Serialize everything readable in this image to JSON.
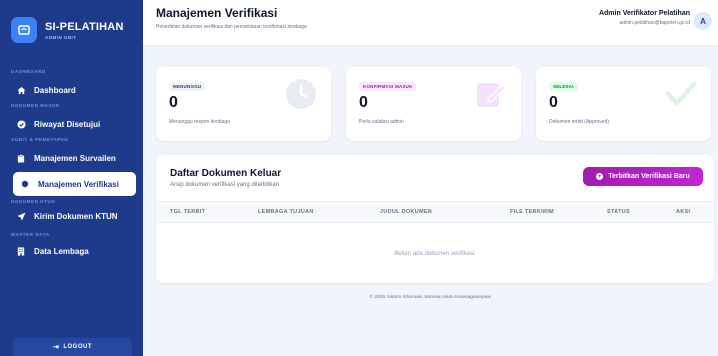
{
  "sidebar": {
    "brand_title": "SI-PELATIHAN",
    "brand_subtitle": "ADMIN UNIT",
    "sections": [
      "DASHBOARD",
      "DOKUMEN MASUK",
      "AUDIT & PEMETAPAN",
      "DOKUMEN KTUN",
      "MASTER DATA"
    ],
    "items": [
      {
        "label": "Dashboard",
        "icon": "home-icon"
      },
      {
        "label": "Riwayat Disetujui",
        "icon": "check-circle-icon"
      },
      {
        "label": "Manajemen Survailen",
        "icon": "clipboard-icon"
      },
      {
        "label": "Manajemen Verifikasi",
        "icon": "bullet-icon",
        "active": true
      },
      {
        "label": "Kirim Dokumen KTUN",
        "icon": "send-icon"
      },
      {
        "label": "Data Lembaga",
        "icon": "building-icon"
      }
    ],
    "logout_label": "LOGOUT"
  },
  "header": {
    "title": "Manajemen Verifikasi",
    "subtitle": "Penerbitan dokumen verifikasi dan pemantauan konfirmasi lembaga",
    "user_name": "Admin Verifikator Pelatihan",
    "user_email": "admin.pelatihan@bapeten.go.id",
    "avatar_initial": "A"
  },
  "stats": [
    {
      "badge": "MENUNGGU",
      "value": "0",
      "caption": "Menunggu respon lembaga",
      "icon": "clock-icon",
      "badge_bg": "#eef2f7",
      "badge_color": "#334155"
    },
    {
      "badge": "KONFIRMASI MASUK",
      "value": "0",
      "caption": "Perlu validasi admin",
      "icon": "edit-icon",
      "badge_bg": "#fae8ff",
      "badge_color": "#a21caf"
    },
    {
      "badge": "SELESAI",
      "value": "0",
      "caption": "Dokumen terbit (Approved)",
      "icon": "checkmark-icon",
      "badge_bg": "#dcfce7",
      "badge_color": "#15803d"
    }
  ],
  "panel": {
    "title": "Daftar Dokumen Keluar",
    "subtitle": "Arsip dokumen verifikasi yang diterbitkan",
    "button_label": "Terbitkan Verifikasi Baru",
    "columns": [
      "TGL TERBIT",
      "LEMBAGA TUJUAN",
      "JUDUL DOKUMEN",
      "FILE TERKIRIM",
      "STATUS",
      "AKSI"
    ],
    "empty_text": "Belum ada dokumen verifikasi."
  },
  "footer": "© 2026 Sistem Informasi Jaminan Mutu Ketenagakerjaan",
  "colors": {
    "sidebar_bg": "#1e3a8a",
    "accent": "#a21caf",
    "page_bg": "#f1f4fa"
  }
}
